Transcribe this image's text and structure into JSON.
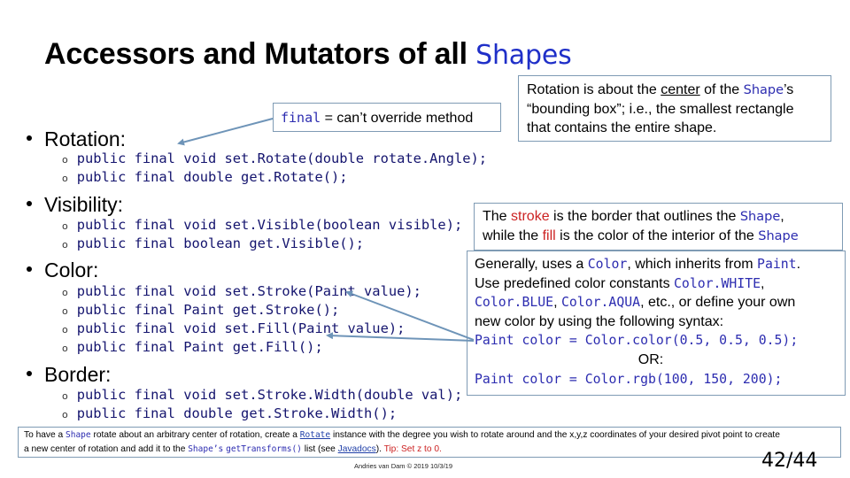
{
  "title": {
    "prefix": "Accessors and Mutators of all ",
    "shape_word": "Shapes"
  },
  "sections": [
    {
      "heading": "Rotation:",
      "lines": [
        "public final void set.Rotate(double rotate.Angle);",
        "public final double get.Rotate();"
      ]
    },
    {
      "heading": "Visibility:",
      "lines": [
        "public final void set.Visible(boolean visible);",
        "public final boolean get.Visible();"
      ]
    },
    {
      "heading": "Color:",
      "lines": [
        "public final void set.Stroke(Paint value);",
        "public final Paint get.Stroke();",
        "public final void set.Fill(Paint value);",
        "public final Paint get.Fill();"
      ]
    },
    {
      "heading": "Border:",
      "lines": [
        "public final void set.Stroke.Width(double val);",
        "public final double get.Stroke.Width();"
      ]
    }
  ],
  "callouts": {
    "final_note": {
      "code": "final",
      "text": " = can’t override method"
    },
    "rotation_note": {
      "part1": "Rotation is about the ",
      "underlined": "center",
      "part2": " of the ",
      "shape": "Shape",
      "part3": "’s",
      "line2": "“bounding box”; i.e., the smallest rectangle",
      "line3": "that contains the entire shape."
    },
    "stroke_note": {
      "w1": "The ",
      "stroke": "stroke",
      "w2": " is the border that outlines the ",
      "shape1": "Shape",
      "w3": ",",
      "w4": "while the ",
      "fill": "fill",
      "w5": " is the color of the interior of the ",
      "shape2": "Shape"
    },
    "color_note": {
      "l1a": "Generally, uses a ",
      "l1b": "Color",
      "l1c": ", which inherits from ",
      "l1d": "Paint",
      "l1e": ".",
      "l2a": "Use predefined color constants ",
      "l2b": "Color.WHITE",
      "l2c": ",",
      "l3a": "Color.BLUE",
      "l3b": ", ",
      "l3c": "Color.AQUA",
      "l3d": ", etc., or define your own",
      "l4": "new color by using the following syntax:",
      "l5": "Paint color = Color.color(0.5, 0.5, 0.5);",
      "l6": "OR:",
      "l7": "Paint color = Color.rgb(100, 150, 200);"
    }
  },
  "footer": {
    "t1": "To have a ",
    "shape": "Shape",
    "t2": " rotate about an arbitrary center of rotation, create a ",
    "rotate_link": "Rotate",
    "t3": " instance with the degree you wish to rotate around and the x,y,z coordinates of your desired pivot point to create",
    "t4": "a new center of rotation and add it to the ",
    "shapes_code": "Shape’s",
    "get_transforms": "getTransforms()",
    "t5": " list (see ",
    "javadocs_link": "Javadocs",
    "t6": "). ",
    "tip": "Tip: Set z to 0."
  },
  "credit": "Andries van Dam © 2019 10/3/19",
  "page_number": "42/44"
}
